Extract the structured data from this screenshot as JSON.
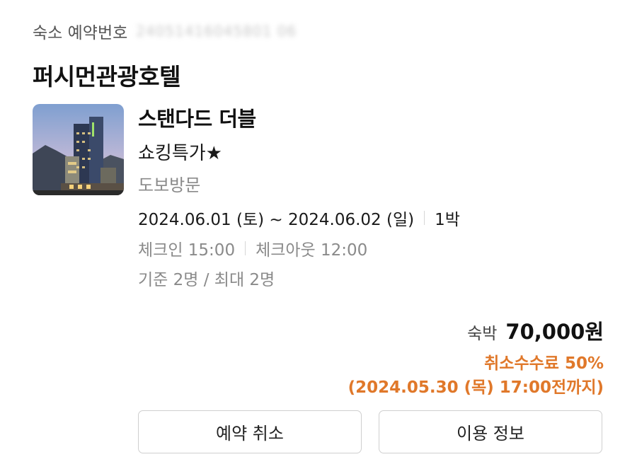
{
  "reservation": {
    "label": "숙소 예약번호",
    "number": "24051416045801 06"
  },
  "hotel": {
    "name": "퍼시먼관광호텔"
  },
  "room": {
    "name": "스탠다드 더블",
    "rate_plan": "쇼킹특가★",
    "visit_type": "도보방문"
  },
  "stay": {
    "dates": "2024.06.01 (토) ~ 2024.06.02 (일)",
    "nights": "1박",
    "checkin": "체크인 15:00",
    "checkout": "체크아웃 12:00",
    "occupancy": "기준 2명 / 최대 2명"
  },
  "price": {
    "label": "숙박",
    "amount": "70,000원"
  },
  "cancellation": {
    "fee": "취소수수료 50%",
    "deadline": "(2024.05.30 (목) 17:00전까지)"
  },
  "buttons": {
    "cancel": "예약 취소",
    "info": "이용 정보"
  },
  "colors": {
    "accent_orange": "#e0782a",
    "text_primary": "#111111",
    "text_secondary": "#8a8a8a",
    "border": "#cfcfcf"
  }
}
